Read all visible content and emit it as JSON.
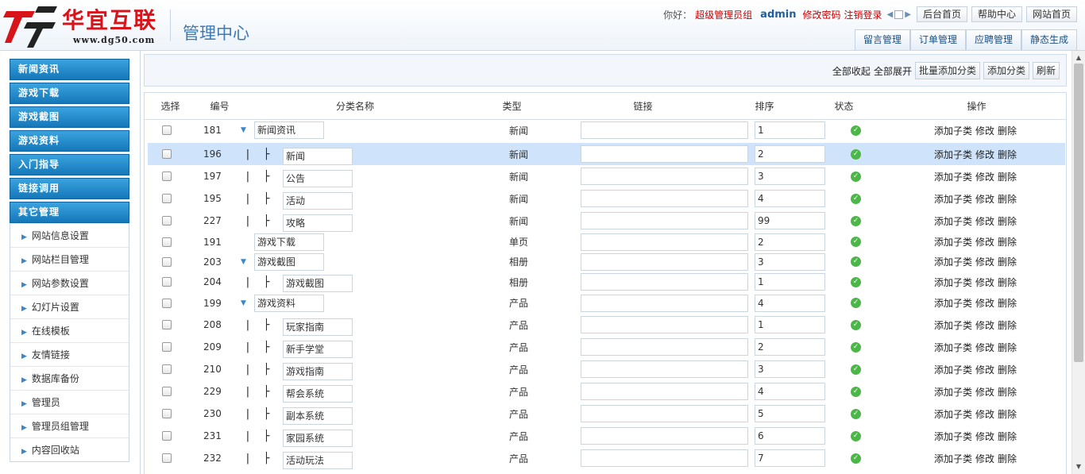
{
  "logo": {
    "cn": "华宜互联",
    "url": "www.dg50.com"
  },
  "header": {
    "system_title": "管理中心",
    "greeting": "你好：",
    "role": "超级管理员组",
    "username": "admin",
    "change_password": "修改密码",
    "logout": "注销登录",
    "buttons": [
      "后台首页",
      "帮助中心",
      "网站首页"
    ],
    "tabs": [
      "留言管理",
      "订单管理",
      "应聘管理",
      "静态生成"
    ]
  },
  "sidebar": {
    "menus": [
      "新闻资讯",
      "游戏下载",
      "游戏截图",
      "游戏资料",
      "入门指导",
      "链接调用",
      "其它管理"
    ],
    "subitems": [
      "网站信息设置",
      "网站栏目管理",
      "网站参数设置",
      "幻灯片设置",
      "在线模板",
      "友情链接",
      "数据库备份",
      "管理员",
      "管理员组管理",
      "内容回收站"
    ]
  },
  "toolbar": {
    "collapse_all": "全部收起",
    "expand_all": "全部展开",
    "batch_add": "批量添加分类",
    "add": "添加分类",
    "refresh": "刷新"
  },
  "table": {
    "headers": {
      "select": "选择",
      "id": "编号",
      "name": "分类名称",
      "type": "类型",
      "link": "链接",
      "sort": "排序",
      "status": "状态",
      "ops": "操作"
    },
    "ops": {
      "add_child": "添加子类",
      "edit": "修改",
      "delete": "删除"
    },
    "rows": [
      {
        "id": "181",
        "name": "新闻资讯",
        "type": "新闻",
        "sort": "1",
        "level": 0,
        "toggle": true
      },
      {
        "id": "196",
        "name": "新闻",
        "type": "新闻",
        "sort": "2",
        "level": 1
      },
      {
        "id": "197",
        "name": "公告",
        "type": "新闻",
        "sort": "3",
        "level": 1
      },
      {
        "id": "195",
        "name": "活动",
        "type": "新闻",
        "sort": "4",
        "level": 1
      },
      {
        "id": "227",
        "name": "攻略",
        "type": "新闻",
        "sort": "99",
        "level": 1
      },
      {
        "id": "191",
        "name": "游戏下载",
        "type": "单页",
        "sort": "2",
        "level": 0,
        "toggle": false
      },
      {
        "id": "203",
        "name": "游戏截图",
        "type": "相册",
        "sort": "3",
        "level": 0,
        "toggle": true
      },
      {
        "id": "204",
        "name": "游戏截图",
        "type": "相册",
        "sort": "1",
        "level": 1
      },
      {
        "id": "199",
        "name": "游戏资料",
        "type": "产品",
        "sort": "4",
        "level": 0,
        "toggle": true
      },
      {
        "id": "208",
        "name": "玩家指南",
        "type": "产品",
        "sort": "1",
        "level": 1
      },
      {
        "id": "209",
        "name": "新手学堂",
        "type": "产品",
        "sort": "2",
        "level": 1
      },
      {
        "id": "210",
        "name": "游戏指南",
        "type": "产品",
        "sort": "3",
        "level": 1
      },
      {
        "id": "229",
        "name": "帮会系统",
        "type": "产品",
        "sort": "4",
        "level": 1
      },
      {
        "id": "230",
        "name": "副本系统",
        "type": "产品",
        "sort": "5",
        "level": 1
      },
      {
        "id": "231",
        "name": "家园系统",
        "type": "产品",
        "sort": "6",
        "level": 1
      },
      {
        "id": "232",
        "name": "活动玩法",
        "type": "产品",
        "sort": "7",
        "level": 1
      }
    ],
    "selected_row": 1
  }
}
